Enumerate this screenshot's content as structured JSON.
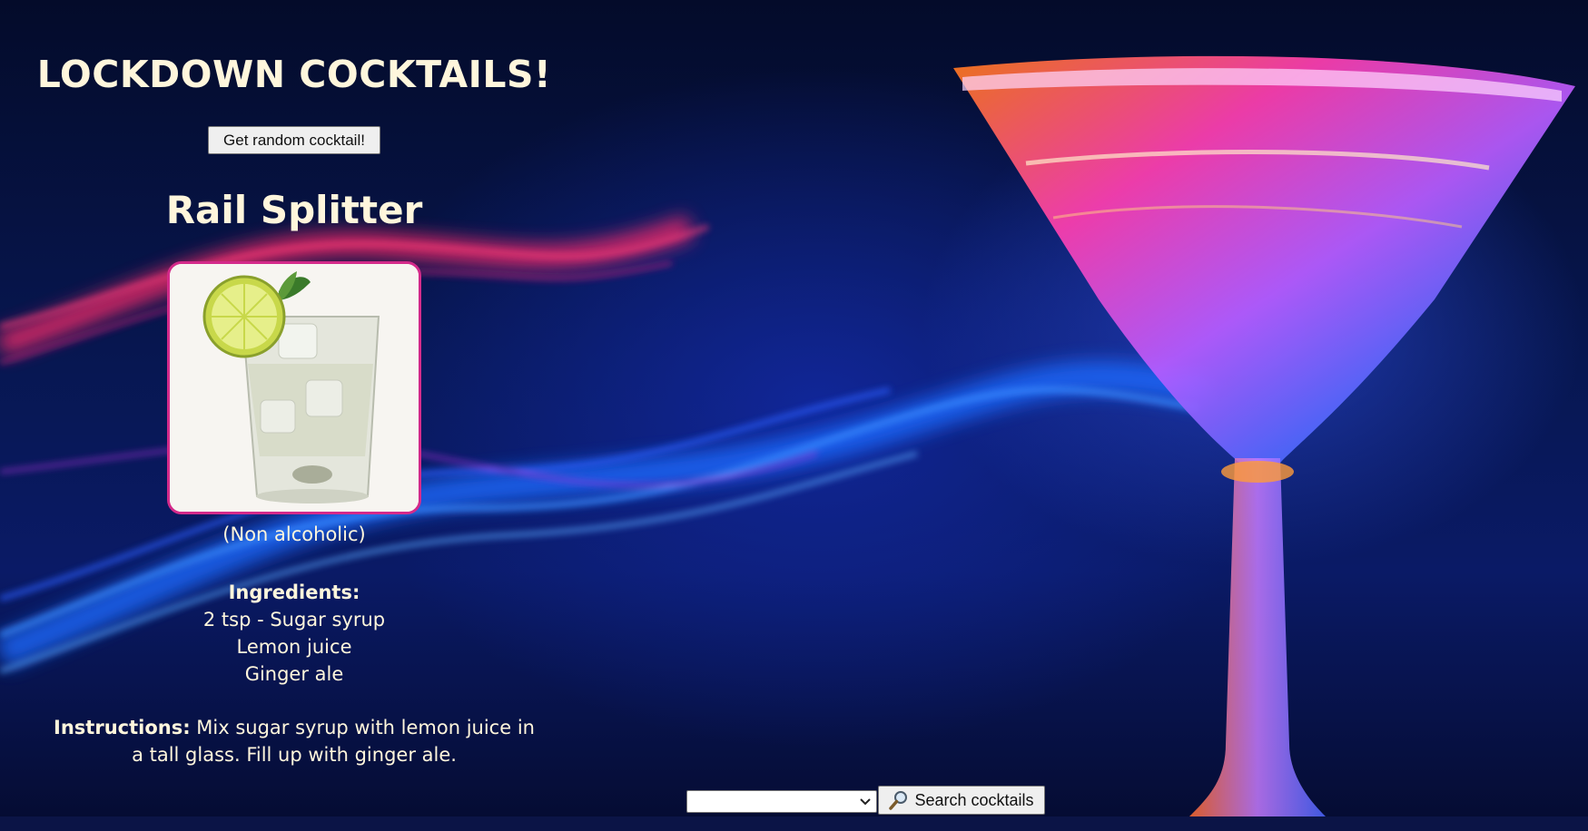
{
  "app": {
    "title": "LOCKDOWN COCKTAILS!",
    "random_button_label": "Get random cocktail!"
  },
  "drink": {
    "name": "Rail Splitter",
    "alcoholic_label": "(Non alcoholic)",
    "photo_icon": "glass-with-lime-icon",
    "ingredients_heading": "Ingredients:",
    "ingredients": [
      "2 tsp - Sugar syrup",
      "Lemon juice",
      "Ginger ale"
    ],
    "instructions_heading": "Instructions:",
    "instructions": "Mix sugar syrup with lemon juice in a tall glass. Fill up with ginger ale."
  },
  "search": {
    "select_value": "",
    "button_label": "Search cocktails",
    "button_icon": "magnifier-icon"
  },
  "colors": {
    "text": "#fff6dc",
    "photo_border": "#d42a8a",
    "background": "#0a1346"
  }
}
